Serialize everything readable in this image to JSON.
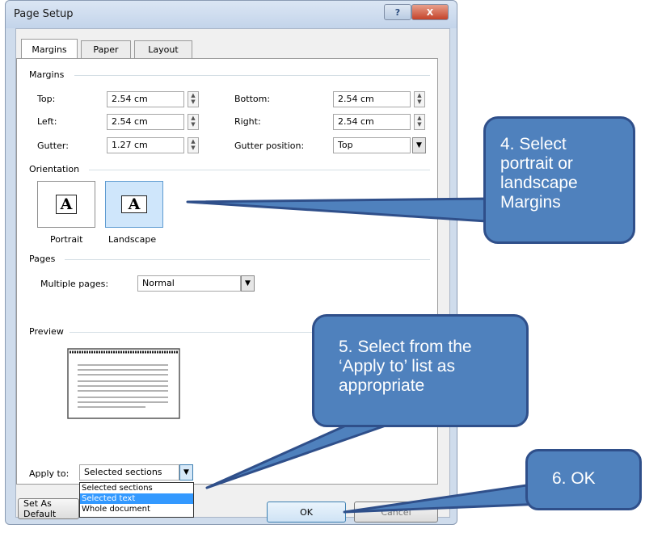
{
  "dialog": {
    "title": "Page Setup",
    "help_label": "?",
    "close_label": "X"
  },
  "tabs": [
    {
      "label": "Margins",
      "active": true
    },
    {
      "label": "Paper",
      "active": false
    },
    {
      "label": "Layout",
      "active": false
    }
  ],
  "margins": {
    "group_label": "Margins",
    "top_label": "Top:",
    "top_value": "2.54 cm",
    "bottom_label": "Bottom:",
    "bottom_value": "2.54 cm",
    "left_label": "Left:",
    "left_value": "2.54 cm",
    "right_label": "Right:",
    "right_value": "2.54 cm",
    "gutter_label": "Gutter:",
    "gutter_value": "1.27 cm",
    "gutter_position_label": "Gutter position:",
    "gutter_position_value": "Top"
  },
  "orientation": {
    "group_label": "Orientation",
    "portrait_label": "Portrait",
    "landscape_label": "Landscape",
    "selected": "Landscape",
    "glyph": "A"
  },
  "pages": {
    "group_label": "Pages",
    "multiple_pages_label": "Multiple pages:",
    "multiple_pages_value": "Normal"
  },
  "preview": {
    "group_label": "Preview"
  },
  "apply_to": {
    "label": "Apply to:",
    "value": "Selected sections",
    "options": [
      "Selected sections",
      "Selected text",
      "Whole document"
    ],
    "highlighted": "Selected text"
  },
  "buttons": {
    "set_as_default": "Set As Default",
    "ok": "OK",
    "cancel": "Cancel"
  },
  "callouts": {
    "orientation": "4. Select portrait or landscape Margins",
    "apply_to": "5. Select from the ‘Apply to’ list as appropriate",
    "ok": "6. OK"
  },
  "colors": {
    "callout_fill": "#4f81bd",
    "callout_border": "#2f4f8a",
    "list_highlight": "#3399ff"
  }
}
